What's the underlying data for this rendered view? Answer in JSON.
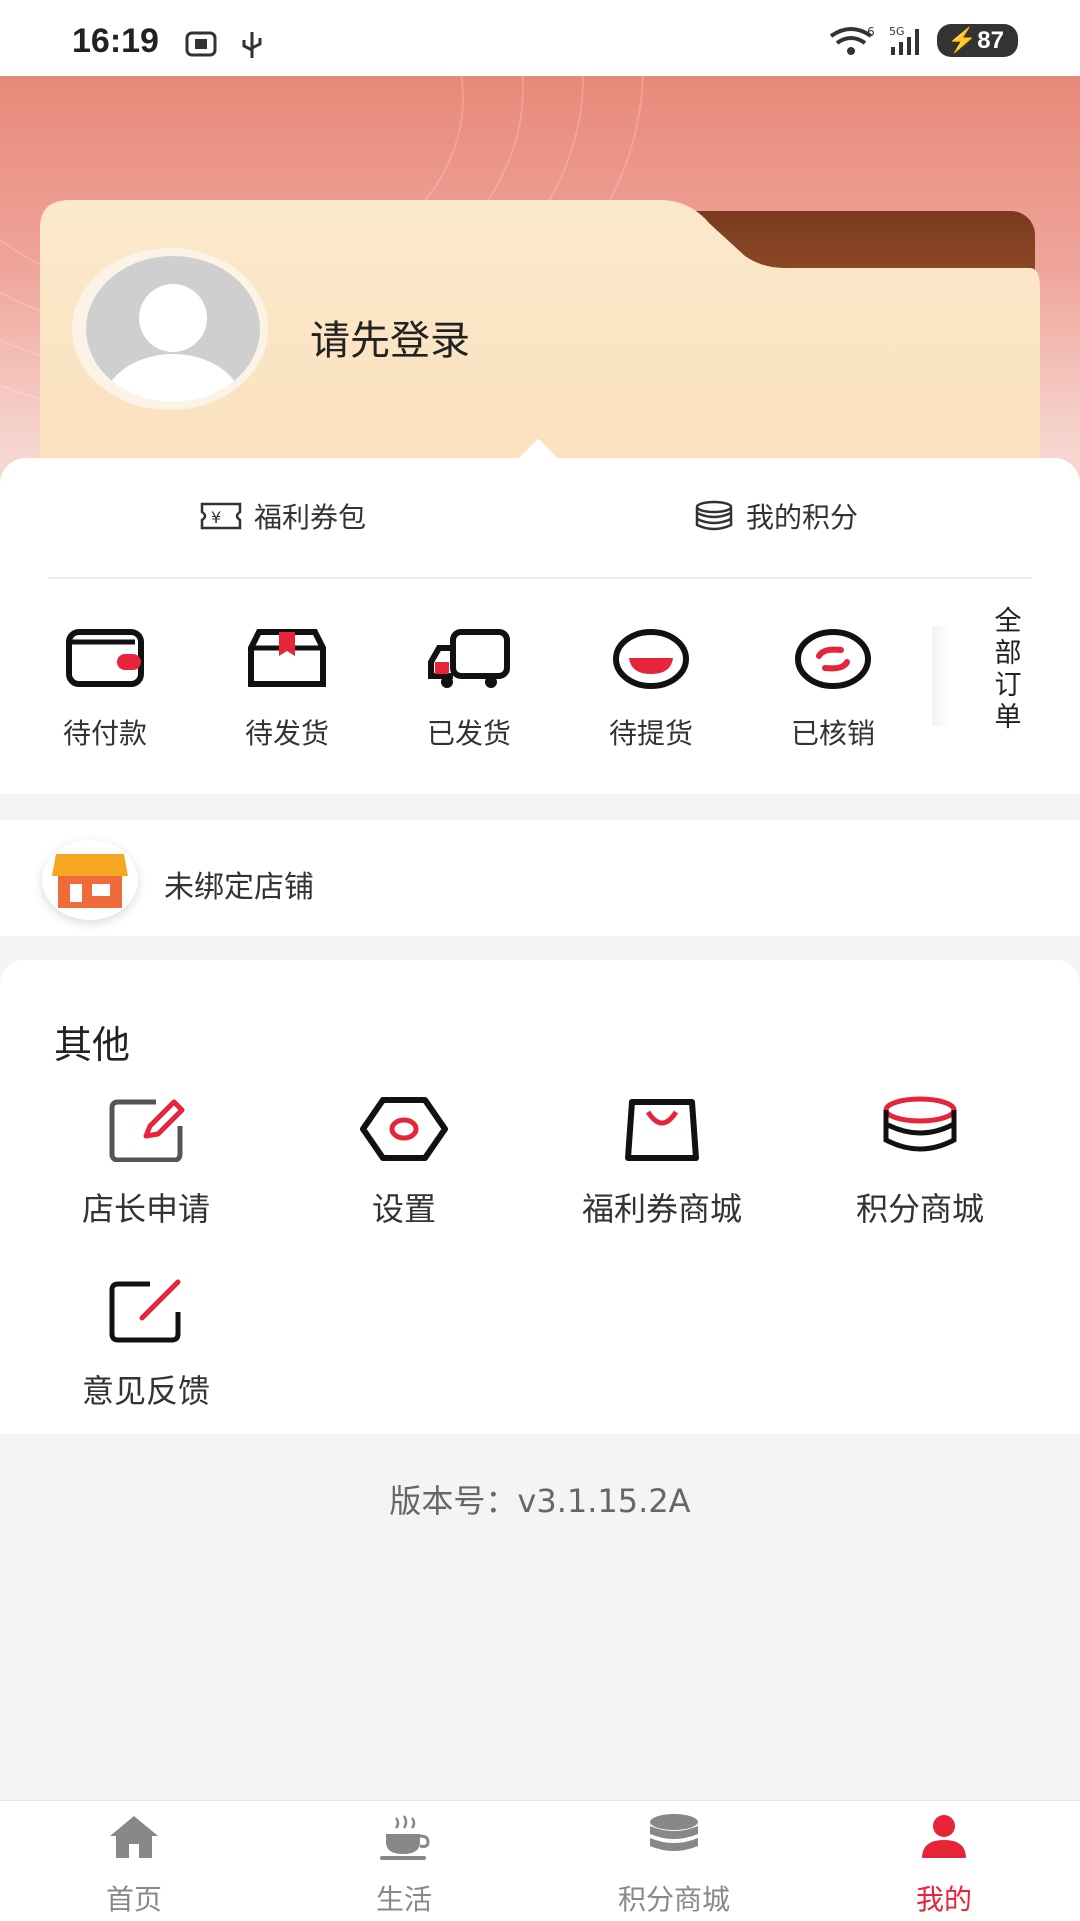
{
  "status_bar": {
    "time": "16:19",
    "battery": "87",
    "net_wifi_sup": "6",
    "net_cell": "5G"
  },
  "profile": {
    "login_prompt": "请先登录"
  },
  "quick_links": {
    "coupon_wallet": "福利券包",
    "my_points": "我的积分"
  },
  "orders": {
    "items": [
      {
        "label": "待付款",
        "icon": "wallet-icon"
      },
      {
        "label": "待发货",
        "icon": "box-icon"
      },
      {
        "label": "已发货",
        "icon": "truck-icon"
      },
      {
        "label": "待提货",
        "icon": "pickup-icon"
      },
      {
        "label": "已核销",
        "icon": "verified-icon"
      }
    ],
    "all_orders_label": "全部订单"
  },
  "store": {
    "label": "未绑定店铺"
  },
  "others": {
    "title": "其他",
    "items": [
      {
        "label": "店长申请",
        "icon": "edit-form-icon"
      },
      {
        "label": "设置",
        "icon": "settings-hexagon-icon"
      },
      {
        "label": "福利券商城",
        "icon": "shopping-bag-icon"
      },
      {
        "label": "积分商城",
        "icon": "coin-stack-icon"
      },
      {
        "label": "意见反馈",
        "icon": "feedback-icon"
      }
    ]
  },
  "version": "版本号：v3.1.15.2A",
  "tabbar": {
    "items": [
      {
        "label": "首页",
        "icon": "home-icon"
      },
      {
        "label": "生活",
        "icon": "coffee-icon"
      },
      {
        "label": "积分商城",
        "icon": "coins-icon"
      },
      {
        "label": "我的",
        "icon": "user-icon"
      }
    ],
    "active": "我的"
  },
  "colors": {
    "accent": "#e8243a",
    "hero_top": "#e8897a",
    "card": "#fbe7c4"
  }
}
